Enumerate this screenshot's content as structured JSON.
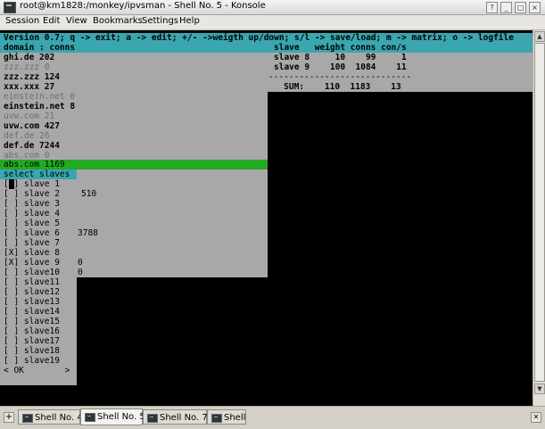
{
  "window": {
    "title": "root@km1828:/monkey/ipvsman - Shell No. 5 - Konsole",
    "buttons": {
      "help": "?",
      "minimize": "_",
      "maximize": "□",
      "close": "×"
    }
  },
  "menu": [
    "Session",
    "Edit",
    "View",
    "Bookmarks",
    "Settings",
    "Help"
  ],
  "terminal": {
    "status_line": "Version 0.7; q -> exit; a -> edit; +/- ->weigth up/down; s/l -> save/load; m -> matrix; o -> logfile",
    "domain_header": "domain : conns",
    "domains": [
      {
        "text": "ghi.de 202",
        "style": "bold"
      },
      {
        "text": "zzz.zzz 0",
        "style": "grey"
      },
      {
        "text": "zzz.zzz 124",
        "style": "bold"
      },
      {
        "text": "xxx.xxx 27",
        "style": "bold"
      },
      {
        "text": "einstein.net 0",
        "style": "grey"
      },
      {
        "text": "einstein.net 8",
        "style": "bold"
      },
      {
        "text": "uvw.com 21",
        "style": "grey"
      },
      {
        "text": "uvw.com 427",
        "style": "bold"
      },
      {
        "text": "def.de 26",
        "style": "grey"
      },
      {
        "text": "def.de 7244",
        "style": "bold"
      },
      {
        "text": "abs.com 0",
        "style": "grey"
      },
      {
        "text": "abs.com 1169",
        "style": "normal"
      }
    ],
    "stats": {
      "header": "slave   weight conns con/s",
      "rows": [
        "slave 8     10    99     1",
        "slave 9    100  1084    11"
      ],
      "separator": "----------------------------",
      "sum": "   SUM:    110  1183    13"
    },
    "select_title": "select slaves",
    "slaves": [
      {
        "text": "[ ] slave 1",
        "count": ""
      },
      {
        "text": "[ ] slave 2",
        "count": "510"
      },
      {
        "text": "[ ] slave 3",
        "count": ""
      },
      {
        "text": "[ ] slave 4",
        "count": ""
      },
      {
        "text": "[ ] slave 5",
        "count": ""
      },
      {
        "text": "[ ] slave 6",
        "count": "3788"
      },
      {
        "text": "[ ] slave 7",
        "count": ""
      },
      {
        "text": "[X] slave 8",
        "count": ""
      },
      {
        "text": "[X] slave 9",
        "count": "0"
      },
      {
        "text": "[ ] slave10",
        "count": "0"
      },
      {
        "text": "[ ] slave11",
        "count": ""
      },
      {
        "text": "[ ] slave12",
        "count": ""
      },
      {
        "text": "[ ] slave13",
        "count": ""
      },
      {
        "text": "[ ] slave14",
        "count": ""
      },
      {
        "text": "[ ] slave15",
        "count": ""
      },
      {
        "text": "[ ] slave16",
        "count": ""
      },
      {
        "text": "[ ] slave17",
        "count": ""
      },
      {
        "text": "[ ] slave18",
        "count": ""
      },
      {
        "text": "[ ] slave19",
        "count": ""
      }
    ],
    "ok_line": "< OK        >"
  },
  "tabs": [
    {
      "label": "Shell No. 4",
      "active": false
    },
    {
      "label": "Shell No. 5",
      "active": true
    },
    {
      "label": "Shell No. 7",
      "active": false
    },
    {
      "label": "Shell",
      "active": false
    }
  ],
  "colors": {
    "header_bg": "#3aa6b0",
    "selected_bg": "#22aa22",
    "panel_bg": "#a8a8a8",
    "terminal_bg": "#000000"
  }
}
